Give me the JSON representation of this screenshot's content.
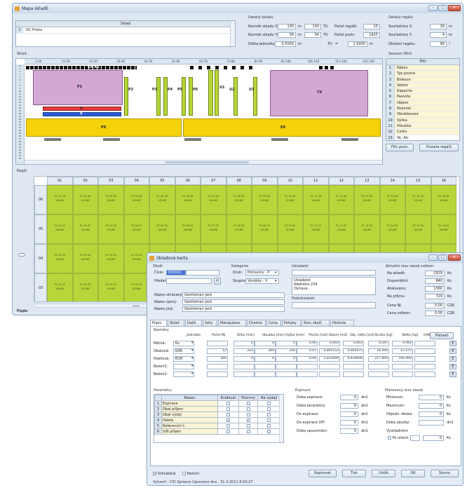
{
  "main": {
    "title": "Mapa skladů",
    "sklad_list": {
      "header": "Sklad",
      "row_no": "1",
      "row_name": "DC Praha"
    },
    "detail": {
      "title": "Detaily skladu",
      "rozmer_x_label": "Rozměr skladu X:",
      "rozmer_x_m": "130",
      "rozmer_x_tu": "130",
      "unit_m": "m",
      "unit_tu": "TU",
      "rozmer_y_label": "Rozměr skladu Y:",
      "rozmer_y_m": "34",
      "rozmer_y_tu": "34",
      "delka_label": "Délka jednotky:",
      "delka_m": "0.5000",
      "tu_eq": "TU",
      "eq": "=",
      "tu_val": "1.0000",
      "pocet_regalu_label": "Počet regálů:",
      "pocet_regalu": "25",
      "pocet_pozic_label": "Počet pozic:",
      "pocet_pozic": "1825"
    },
    "regal_detail": {
      "title": "Detaily regálu",
      "sx_label": "Souřadnice X:",
      "sx": "39",
      "sy_label": "Souřadnice Y:",
      "sy": "4",
      "rot_label": "Otočení regálu:",
      "rot": "90",
      "unit_m": "m",
      "unit_deg": "°"
    },
    "sklad_label": "Sklad",
    "filtry": {
      "title": "Seznam filtrů",
      "header": "Filtr",
      "items": [
        "Název",
        "Typ pozice",
        "Blokace",
        "Sektor",
        "Kapacita",
        "Pasivita",
        "Objem",
        "Nosnost",
        "Obrátkovost",
        "Výška",
        "Hloubka",
        "Cesta",
        "Sk. Atr"
      ],
      "btn_filtr": "Filtr pozic",
      "btn_prozet": "Prozeta regálů"
    },
    "map_cols": [
      "1-10",
      "11-20",
      "21-30",
      "31-40",
      "41-50",
      "51-60",
      "61-70",
      "71-80",
      "81-90",
      "91-100",
      "101-110",
      "111-120",
      "121-130"
    ],
    "map_rows": [
      "01",
      "2",
      "3",
      "4",
      "5",
      "6",
      "7",
      "8",
      "9",
      "10",
      "11",
      "12",
      "13",
      "14",
      "15",
      "16",
      "17",
      "18",
      "19",
      "20",
      "21",
      "22",
      "23",
      "24",
      "25",
      "26",
      "27",
      "28",
      "29",
      "30",
      "31",
      "32",
      "33",
      "34"
    ],
    "map_labels": {
      "p1": "P1",
      "p2": "P2",
      "p3": "P3",
      "p4": "P4",
      "p5": "P5",
      "p6": "P6",
      "u1": "U1",
      "u2": "U2",
      "u3": "U3",
      "x": "X",
      "y": "Y",
      "px": "PX",
      "ex": "EX",
      "tx": "TX",
      "kr": "KR K1"
    },
    "regal": {
      "title": "Regál",
      "cols": [
        "01",
        "02",
        "03",
        "04",
        "05",
        "06",
        "07",
        "08",
        "09",
        "10",
        "11",
        "12",
        "13",
        "14",
        "15",
        "16"
      ],
      "rows": [
        "06",
        "05",
        "04",
        "03"
      ],
      "row_codes": {
        "06": "P1 01 06",
        "05": "P1 01 05",
        "04": "P1 01 04",
        "03": "P1 01 03"
      },
      "status": "VOLNE",
      "pos_prefix": "P1"
    },
    "popis": "Popis"
  },
  "card": {
    "title": "Skladová karta",
    "zbozi": "Zboží",
    "cislo_label": "Číslo:",
    "cislo": "000001",
    "hledat_label": "Hledat:",
    "h_btn": "H",
    "kategorie": "Kategorie",
    "druh_label": "Druh:",
    "druh": "Potraviny - P",
    "skupina_label": "Skupina:",
    "skupina": "Výrobky - V",
    "ukladatel": "Ukladatel",
    "ukl_name": "Ukladatel",
    "ukl_addr1": "Nádražní 234",
    "ukl_addr2": "Ostrava",
    "podukladatel": "Podukladatel",
    "aktualni": "Aktuální stav zásob celkem",
    "na_sklade_label": "Na skladě:",
    "na_sklade": "2929",
    "disponibilni_label": "Disponibilní:",
    "disponibilni": "840",
    "alokovano_label": "Alokováno:",
    "alokovano": "1360",
    "na_prijmu_label": "Na příjmu:",
    "na_prijmu": "729",
    "unit_ks": "Ks",
    "cena_nj_label": "Cena NJ:",
    "cena_nj": "0.00",
    "cena_celkem_label": "Cena celkem:",
    "cena_celkem": "0.00",
    "czk": "CZK",
    "nazev_zkr_label": "Název zkrácený:",
    "nazev_zkr": "Gentleman Jack",
    "nazev_uziv_label": "Název úplný:",
    "nazev_uziv": "Gentleman Jack",
    "nazev_jiny_label": "Název jiný:",
    "nazev_jiny": "Gentleman Jack",
    "tabs": [
      "Popis",
      "Sklad",
      "Další",
      "Sety",
      "Manipulace",
      "Chemie",
      "Cena",
      "Pohyby",
      "Stav zboží",
      "Historie"
    ],
    "rozmery": "Rozměry",
    "rz_headers": [
      "Jednotka",
      "Počet MJ",
      "Šířka [mm]",
      "Hloubka [mm]",
      "Výška [mm]",
      "Plocha [m2]",
      "Objem [m3]",
      "Obj. netto [m3]",
      "Brutto [kg]",
      "Netto [kg]",
      "EAN"
    ],
    "prebalit": "Přebalit",
    "rz_rows": [
      {
        "label": "Měrná:",
        "unit": "Ks",
        "vals": [
          "",
          "0",
          "0",
          "0",
          "0.00",
          "0.003",
          "0.003",
          "0.547",
          "0.492",
          ""
        ]
      },
      {
        "label": "Obalová:",
        "unit": "KAR",
        "vals": [
          "12",
          "225",
          "300",
          "230",
          "0.07",
          "0.001553",
          "0.001475",
          "18.500",
          "17.575",
          ""
        ]
      },
      {
        "label": "Paletová:",
        "unit": "EUR",
        "vals": [
          "360",
          "0",
          "0",
          "0",
          "0.00",
          "1.021000",
          "0.919000",
          "217.000",
          "195.000",
          ""
        ]
      },
      {
        "label": "Balení1:",
        "unit": "",
        "vals": [
          "",
          "",
          "",
          "",
          "",
          "",
          "",
          "",
          "",
          ""
        ]
      },
      {
        "label": "Balení2:",
        "unit": "",
        "vals": [
          "",
          "",
          "",
          "",
          "",
          "",
          "",
          "",
          "",
          ""
        ]
      }
    ],
    "e": "E",
    "parametry": "Parametry",
    "par_headers": [
      "Název",
      "Evidovat",
      "Povinný",
      "Na výdaji"
    ],
    "par_rows": [
      {
        "n": "1",
        "name": "Expirace"
      },
      {
        "n": "2",
        "name": "Obal příjem"
      },
      {
        "n": "3",
        "name": "Obal výdej"
      },
      {
        "n": "4",
        "name": "Paleta"
      },
      {
        "n": "5",
        "name": "Referenční č."
      },
      {
        "n": "6",
        "name": "S/N příjem"
      }
    ],
    "expirace": "Expirace",
    "doba_exp_label": "Doba expirace:",
    "doba_exp": "0",
    "doba_kar_label": "Doba karantény:",
    "doba_kar": "0",
    "do_exp_label": "Do expirace:",
    "do_exp": "0",
    "do_exp_vip_label": "Do expirace VIP:",
    "do_exp_vip": "0",
    "doba_upoz_label": "Doba upozornění:",
    "doba_upoz": "0",
    "dnu": "dnů",
    "planovany": "Plánovaný stav zásob",
    "minimum_label": "Minimum:",
    "minimum": "0",
    "maximum_label": "Maximum:",
    "maximum": "0",
    "obj_davka_label": "Objedn. dávka:",
    "obj_davka": "0",
    "doba_zasoby_label": "Doba zásoby:",
    "doba_zasoby": "",
    "vyskladneni_label": "Vyskladnění:",
    "po_lotech": "Po lotech",
    "po_lotech_val": "0",
    "ks": "Ks",
    "schvalena": "Schválená",
    "pasivni": "Pasivní",
    "btn_kopirovat": "Kopírovat",
    "btn_tisk": "Tisk",
    "btn_ulozit": "Uložit",
    "btn_ok": "OK",
    "btn_storno": "Storno",
    "footer": "Vytvoril : CID Správce  Upraveno dne : 31.3.2011 8:03:27"
  }
}
